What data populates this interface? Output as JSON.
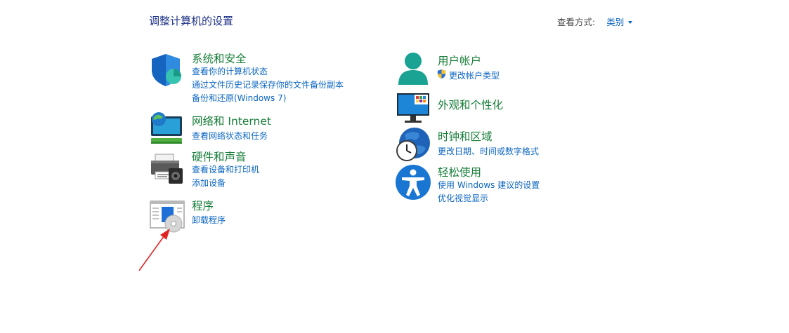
{
  "page_title": "调整计算机的设置",
  "view_by": {
    "label": "查看方式:",
    "selected": "类别"
  },
  "categories": {
    "system": {
      "title": "系统和安全",
      "links": [
        "查看你的计算机状态",
        "通过文件历史记录保存你的文件备份副本",
        "备份和还原(Windows 7)"
      ]
    },
    "network": {
      "title": "网络和 Internet",
      "links": [
        "查看网络状态和任务"
      ]
    },
    "hardware": {
      "title": "硬件和声音",
      "links": [
        "查看设备和打印机",
        "添加设备"
      ]
    },
    "programs": {
      "title": "程序",
      "links": [
        "卸载程序"
      ]
    },
    "accounts": {
      "title": "用户帐户",
      "links": [
        "更改帐户类型"
      ]
    },
    "appearance": {
      "title": "外观和个性化",
      "links": []
    },
    "clock": {
      "title": "时钟和区域",
      "links": [
        "更改日期、时间或数字格式"
      ]
    },
    "ease": {
      "title": "轻松使用",
      "links": [
        "使用 Windows 建议的设置",
        "优化视觉显示"
      ]
    }
  },
  "colors": {
    "title_green": "#167d38",
    "link_blue": "#0b66c2",
    "page_title_blue": "#1e3287",
    "annotation_red": "#e02424"
  },
  "icons": {
    "system": "shield-icon",
    "network": "network-globe-icon",
    "hardware": "printer-icon",
    "programs": "programs-disc-icon",
    "accounts": "user-icon",
    "appearance": "monitor-icon",
    "clock": "clock-globe-icon",
    "ease": "accessibility-icon",
    "uac": "uac-shield-icon",
    "annotation": "red-arrow-annotation"
  }
}
